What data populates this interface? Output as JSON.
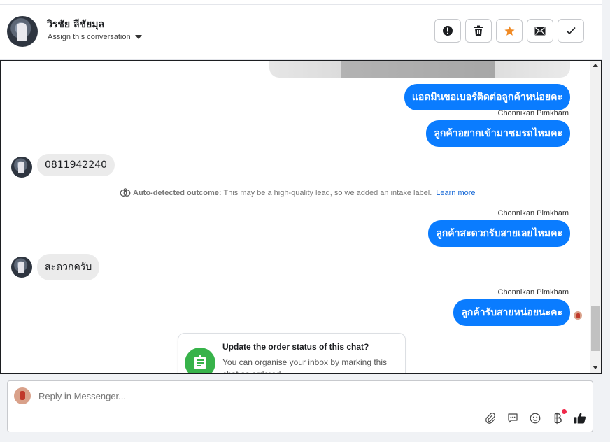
{
  "header": {
    "contact_name": "วิรชัย ลีชัยมุล",
    "assign_label": "Assign this conversation",
    "actions": [
      {
        "name": "mark-spam-button",
        "icon": "alert-circle-icon"
      },
      {
        "name": "delete-button",
        "icon": "trash-icon"
      },
      {
        "name": "star-button",
        "icon": "star-icon",
        "color": "#f08a24"
      },
      {
        "name": "mark-unread-button",
        "icon": "envelope-icon"
      },
      {
        "name": "mark-done-button",
        "icon": "checkmark-icon"
      }
    ]
  },
  "messages": {
    "m1_text": "แอดมินขอเบอร์ติดต่อลูกค้าหน่อยคะ",
    "m2_sender": "Chonnikan Pimkham",
    "m2_text": "ลูกค้าอยากเข้ามาชมรถไหมคะ",
    "m3_text": "0811942240",
    "outcome_label": "Auto-detected outcome:",
    "outcome_text": "This may be a high-quality lead, so we added an intake label.",
    "outcome_link": "Learn more",
    "m4_sender": "Chonnikan Pimkham",
    "m4_text": "ลูกค้าสะดวกรับสายเลยไหมคะ",
    "m5_text": "สะดวกครับ",
    "m6_sender": "Chonnikan Pimkham",
    "m6_text": "ลูกค้ารับสายหน่อยนะคะ"
  },
  "card": {
    "title": "Update the order status of this chat?",
    "body": "You can organise your inbox by marking this chat as ordered."
  },
  "composer": {
    "placeholder": "Reply in Messenger...",
    "tools": [
      "paperclip-icon",
      "saved-reply-icon",
      "emoji-icon",
      "baht-icon",
      "thumbs-up-icon"
    ]
  },
  "colors": {
    "outgoing_bubble": "#0a7cff",
    "incoming_bubble": "#ebebeb",
    "star": "#f08a24",
    "card_icon": "#37b34a",
    "link": "#1668d6"
  }
}
